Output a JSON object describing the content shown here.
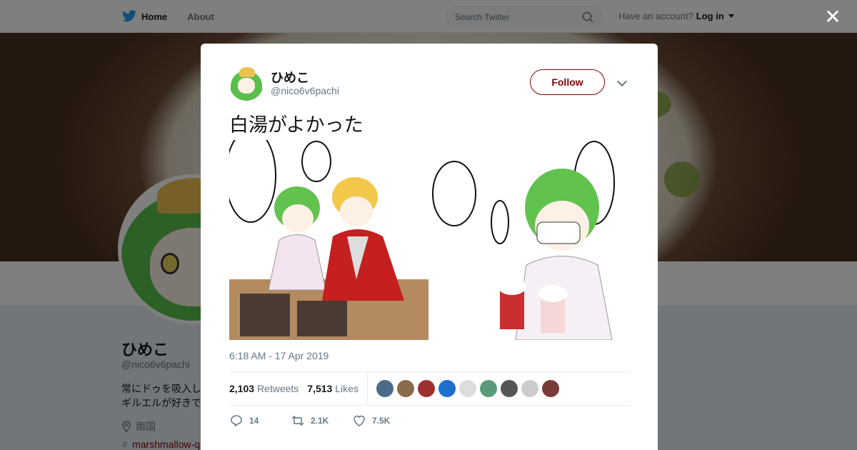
{
  "nav": {
    "home_label": "Home",
    "about_label": "About",
    "search_placeholder": "Search Twitter",
    "account_prompt": "Have an account?",
    "login_label": "Log in"
  },
  "profile_bg": {
    "name": "ひめこ",
    "handle": "@nico6v6pachi",
    "bio_line1": "常にドゥを吸入し",
    "bio_line2": "ギルエルが好きで",
    "location": "南国",
    "link": "marshmallow-q"
  },
  "tweet": {
    "display_name": "ひめこ",
    "handle": "@nico6v6pachi",
    "follow_label": "Follow",
    "text": "白湯がよかった",
    "timestamp": "6:18 AM - 17 Apr 2019",
    "retweets_count": "2,103",
    "retweets_label": "Retweets",
    "likes_count": "7,513",
    "likes_label": "Likes",
    "reply_count": "14",
    "retweet_action_count": "2.1K",
    "like_action_count": "7.5K",
    "liker_colors": [
      "#4a6b8a",
      "#8a6b4a",
      "#a03030",
      "#1f6fd0",
      "#ddd",
      "#5a9a7a",
      "#555",
      "#ccc",
      "#7a3a3a"
    ]
  },
  "colors": {
    "accent": "#8b0000",
    "bird": "#1da1f2"
  }
}
